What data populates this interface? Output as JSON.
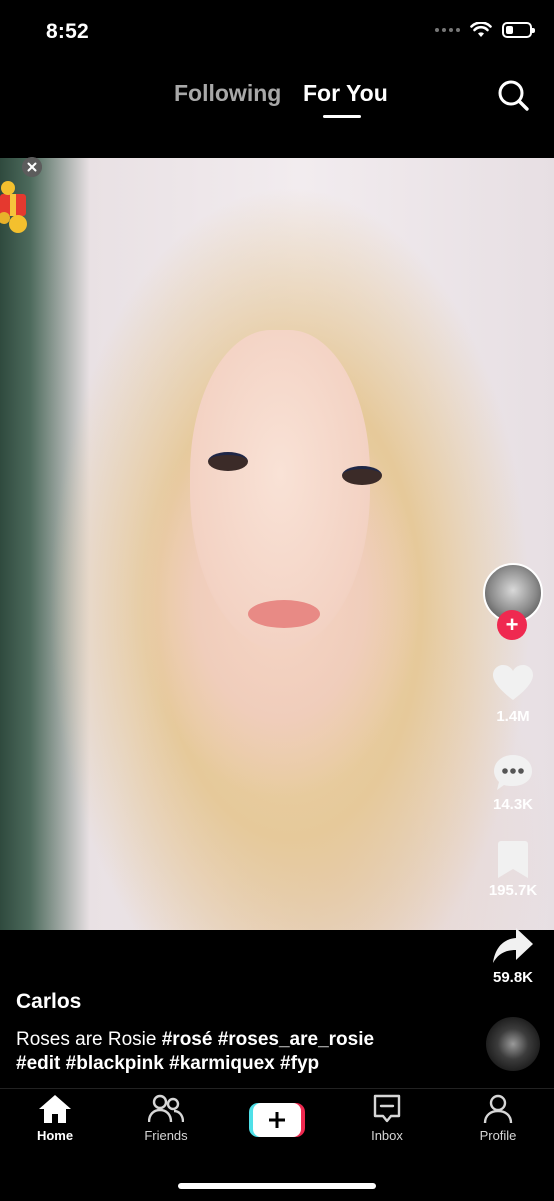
{
  "status_bar": {
    "time": "8:52"
  },
  "top_tabs": {
    "following": "Following",
    "for_you": "For You"
  },
  "post": {
    "username": "Carlos",
    "caption_text": "Roses are Rosie",
    "hashtags_line1": [
      "#rosé",
      "#roses_are_rosie"
    ],
    "hashtags_line2": [
      "#edit",
      "#blackpink",
      "#karmiquex",
      "#fyp"
    ]
  },
  "actions": {
    "likes": "1.4M",
    "comments": "14.3K",
    "saves": "195.7K",
    "shares": "59.8K",
    "follow_symbol": "+"
  },
  "nav": {
    "home": "Home",
    "friends": "Friends",
    "create": "+",
    "inbox": "Inbox",
    "profile": "Profile"
  },
  "colors": {
    "accent_red": "#ef2950",
    "create_cyan": "#4fe0e8",
    "create_pink": "#ef2950",
    "inactive_tab": "#a8a8a8"
  },
  "icons": [
    "search-icon",
    "heart-icon",
    "comment-icon",
    "bookmark-icon",
    "share-icon",
    "home-icon",
    "friends-icon",
    "inbox-icon",
    "profile-icon",
    "plus-icon",
    "close-icon",
    "gift-icon",
    "wifi-icon",
    "battery-icon"
  ]
}
